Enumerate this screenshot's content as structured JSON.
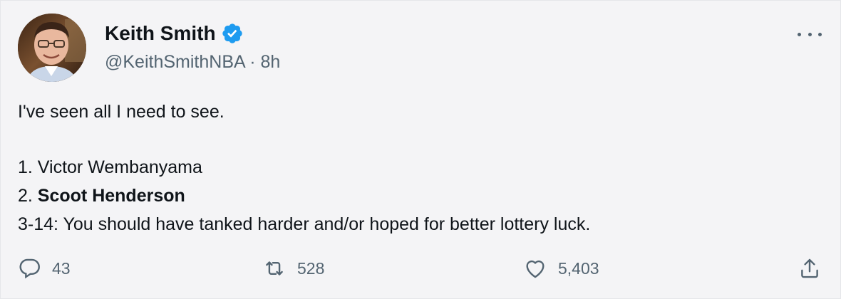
{
  "author": {
    "name": "Keith Smith",
    "handle": "@KeithSmithNBA",
    "separator": "·",
    "time": "8h",
    "verified": true
  },
  "tweet": {
    "text_line_1": "I've seen all I need to see.",
    "list": [
      {
        "prefix": "1. ",
        "name": "Victor Wembanyama"
      },
      {
        "prefix": "2. ",
        "name": "Scoot Henderson"
      }
    ],
    "text_line_3": "3-14: You should have tanked harder and/or hoped for better lottery luck."
  },
  "metrics": {
    "replies": "43",
    "retweets": "528",
    "likes": "5,403"
  },
  "icons": {
    "verified": "verified-badge-icon",
    "more": "more-options-icon",
    "reply": "reply-icon",
    "retweet": "retweet-icon",
    "like": "heart-icon",
    "share": "share-icon"
  },
  "colors": {
    "verified": "#1d9bf0",
    "secondary_text": "#536471",
    "primary_text": "#0f1419",
    "background": "#f4f4f6"
  }
}
